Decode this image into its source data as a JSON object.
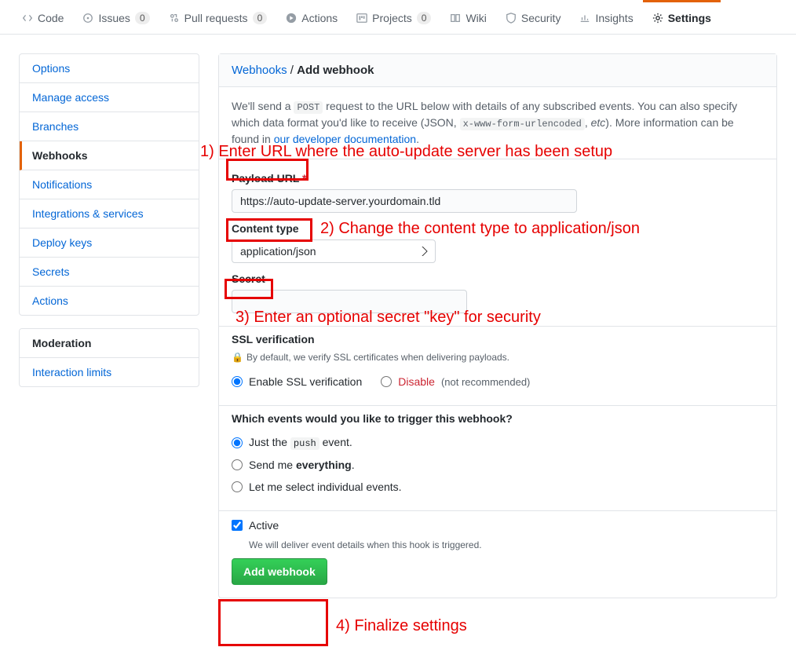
{
  "nav": {
    "tabs": [
      {
        "label": "Code",
        "count": null
      },
      {
        "label": "Issues",
        "count": "0"
      },
      {
        "label": "Pull requests",
        "count": "0"
      },
      {
        "label": "Actions",
        "count": null
      },
      {
        "label": "Projects",
        "count": "0"
      },
      {
        "label": "Wiki",
        "count": null
      },
      {
        "label": "Security",
        "count": null
      },
      {
        "label": "Insights",
        "count": null
      },
      {
        "label": "Settings",
        "count": null
      }
    ]
  },
  "sidebar": {
    "main_items": [
      "Options",
      "Manage access",
      "Branches",
      "Webhooks",
      "Notifications",
      "Integrations & services",
      "Deploy keys",
      "Secrets",
      "Actions"
    ],
    "moderation_title": "Moderation",
    "moderation_items": [
      "Interaction limits"
    ]
  },
  "breadcrumb": {
    "root": "Webhooks",
    "sep": " / ",
    "current": "Add webhook"
  },
  "intro": {
    "prefix": "We'll send a ",
    "post": "POST",
    "mid1": " request to the URL below with details of any subscribed events. You can also specify which data format you'd like to receive (JSON, ",
    "code2": "x-www-form-urlencoded",
    "mid2": ", ",
    "etc": "etc",
    "mid3": "). More information can be found in ",
    "link": "our developer documentation",
    "suffix": "."
  },
  "form": {
    "payload_label": "Payload URL",
    "required_mark": "*",
    "payload_value": "https://auto-update-server.yourdomain.tld",
    "content_type_label": "Content type",
    "content_type_value": "application/json",
    "secret_label": "Secret",
    "secret_value": "",
    "ssl_title": "SSL verification",
    "ssl_hint": "By default, we verify SSL certificates when delivering payloads.",
    "ssl_enable": "Enable SSL verification",
    "ssl_disable": "Disable",
    "ssl_disable_note": "(not recommended)",
    "events_title": "Which events would you like to trigger this webhook?",
    "event_just_prefix": "Just the ",
    "event_just_code": "push",
    "event_just_suffix": " event.",
    "event_everything_prefix": "Send me ",
    "event_everything_bold": "everything",
    "event_everything_suffix": ".",
    "event_select": "Let me select individual events.",
    "active_label": "Active",
    "active_hint": "We will deliver event details when this hook is triggered.",
    "submit": "Add webhook"
  },
  "annotations": {
    "a1": "1) Enter URL where the auto-update server has been setup",
    "a2": "2) Change the content type to application/json",
    "a3": "3) Enter an optional secret \"key\" for security",
    "a4": "4) Finalize settings"
  }
}
